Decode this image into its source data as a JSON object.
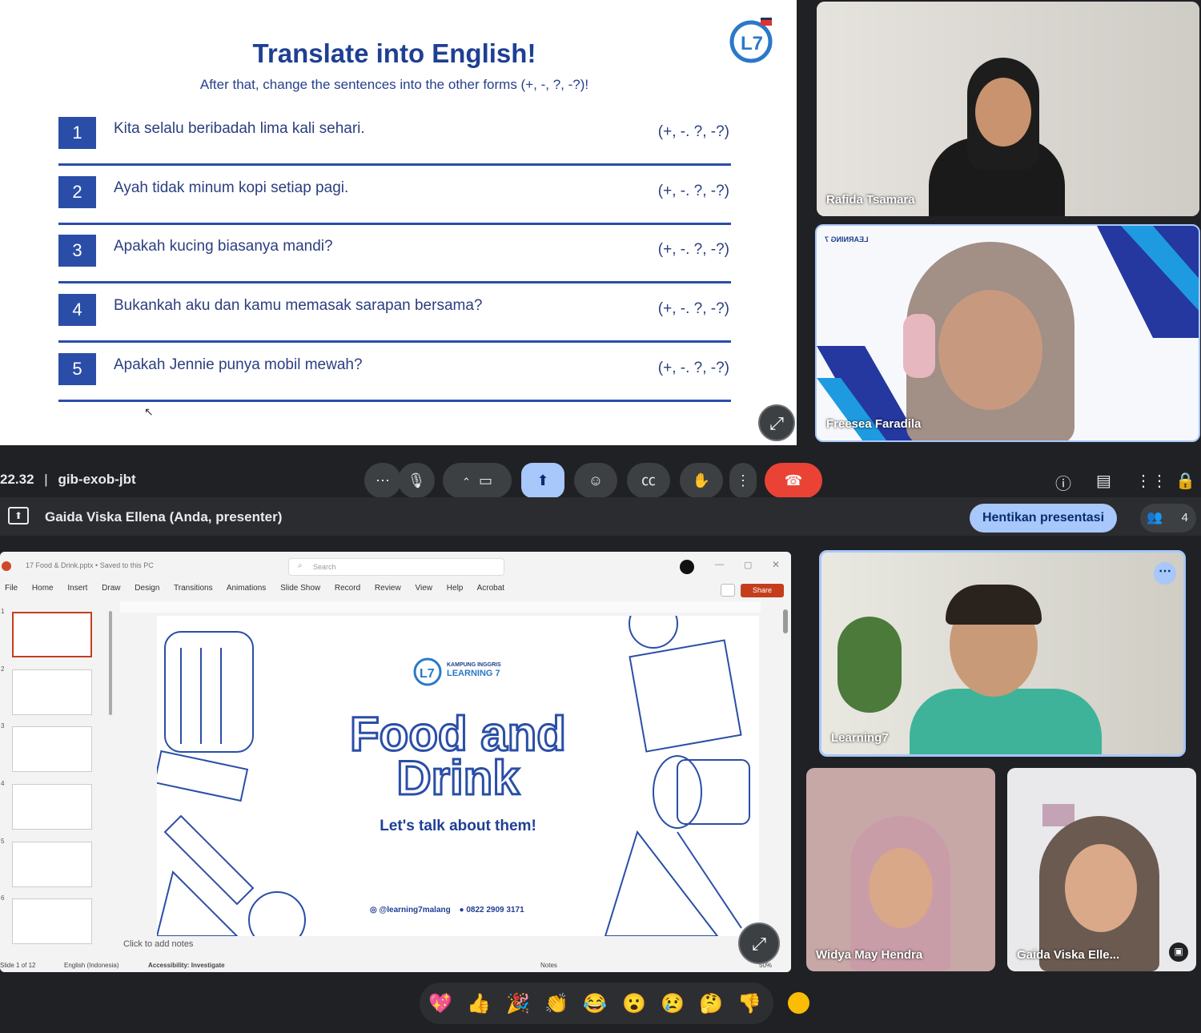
{
  "top": {
    "slide": {
      "title": "Translate into English!",
      "subtitle": "After that, change the sentences into the other forms (+, -, ?, -?)!",
      "items": [
        {
          "num": "1",
          "text": "Kita selalu beribadah lima kali sehari.",
          "forms": "(+, -. ?, -?)"
        },
        {
          "num": "2",
          "text": "Ayah tidak minum kopi setiap pagi.",
          "forms": "(+, -. ?, -?)"
        },
        {
          "num": "3",
          "text": "Apakah kucing biasanya mandi?",
          "forms": "(+, -. ?, -?)"
        },
        {
          "num": "4",
          "text": "Bukankah aku dan kamu memasak sarapan bersama?",
          "forms": "(+, -. ?, -?)"
        },
        {
          "num": "5",
          "text": "Apakah Jennie punya mobil mewah?",
          "forms": "(+, -. ?, -?)"
        }
      ]
    },
    "participants": [
      {
        "name": "Rafida Tsamara"
      },
      {
        "name": "Freesea Faradila"
      }
    ],
    "bar": {
      "time": "22.32",
      "separator": "|",
      "code": "gib-exob-jbt"
    }
  },
  "bottom": {
    "presenter_label": "Gaida Viska Ellena (Anda, presenter)",
    "stop_button": "Hentikan presentasi",
    "participant_count": "4",
    "ppt": {
      "filename": "17 Food & Drink.pptx • Saved to this PC",
      "search_placeholder": "Search",
      "menu": [
        "File",
        "Home",
        "Insert",
        "Draw",
        "Design",
        "Transitions",
        "Animations",
        "Slide Show",
        "Record",
        "Review",
        "View",
        "Help",
        "Acrobat"
      ],
      "share_label": "Share",
      "thumb_numbers": [
        "1",
        "2",
        "3",
        "4",
        "5",
        "6"
      ],
      "slide_title_1": "Food and",
      "slide_title_2": "Drink",
      "slide_subtitle": "Let's talk about them!",
      "logo_small_1": "KAMPUNG INGGRIS",
      "logo_small_2": "LEARNING 7",
      "contact_ig": "@learning7malang",
      "contact_phone": "0822 2909 3171",
      "notes_placeholder": "Click to add notes",
      "status_slide": "Slide 1 of 12",
      "status_lang": "English (Indonesia)",
      "status_access": "Accessibility: Investigate",
      "status_notes": "Notes",
      "status_zoom": "50%"
    },
    "participants": [
      {
        "name": "Learning7"
      },
      {
        "name": "Widya May Hendra"
      },
      {
        "name": "Gaida Viska Elle..."
      }
    ],
    "reactions": [
      "💖",
      "👍",
      "🎉",
      "👏",
      "😂",
      "😮",
      "😢",
      "🤔",
      "👎"
    ]
  }
}
